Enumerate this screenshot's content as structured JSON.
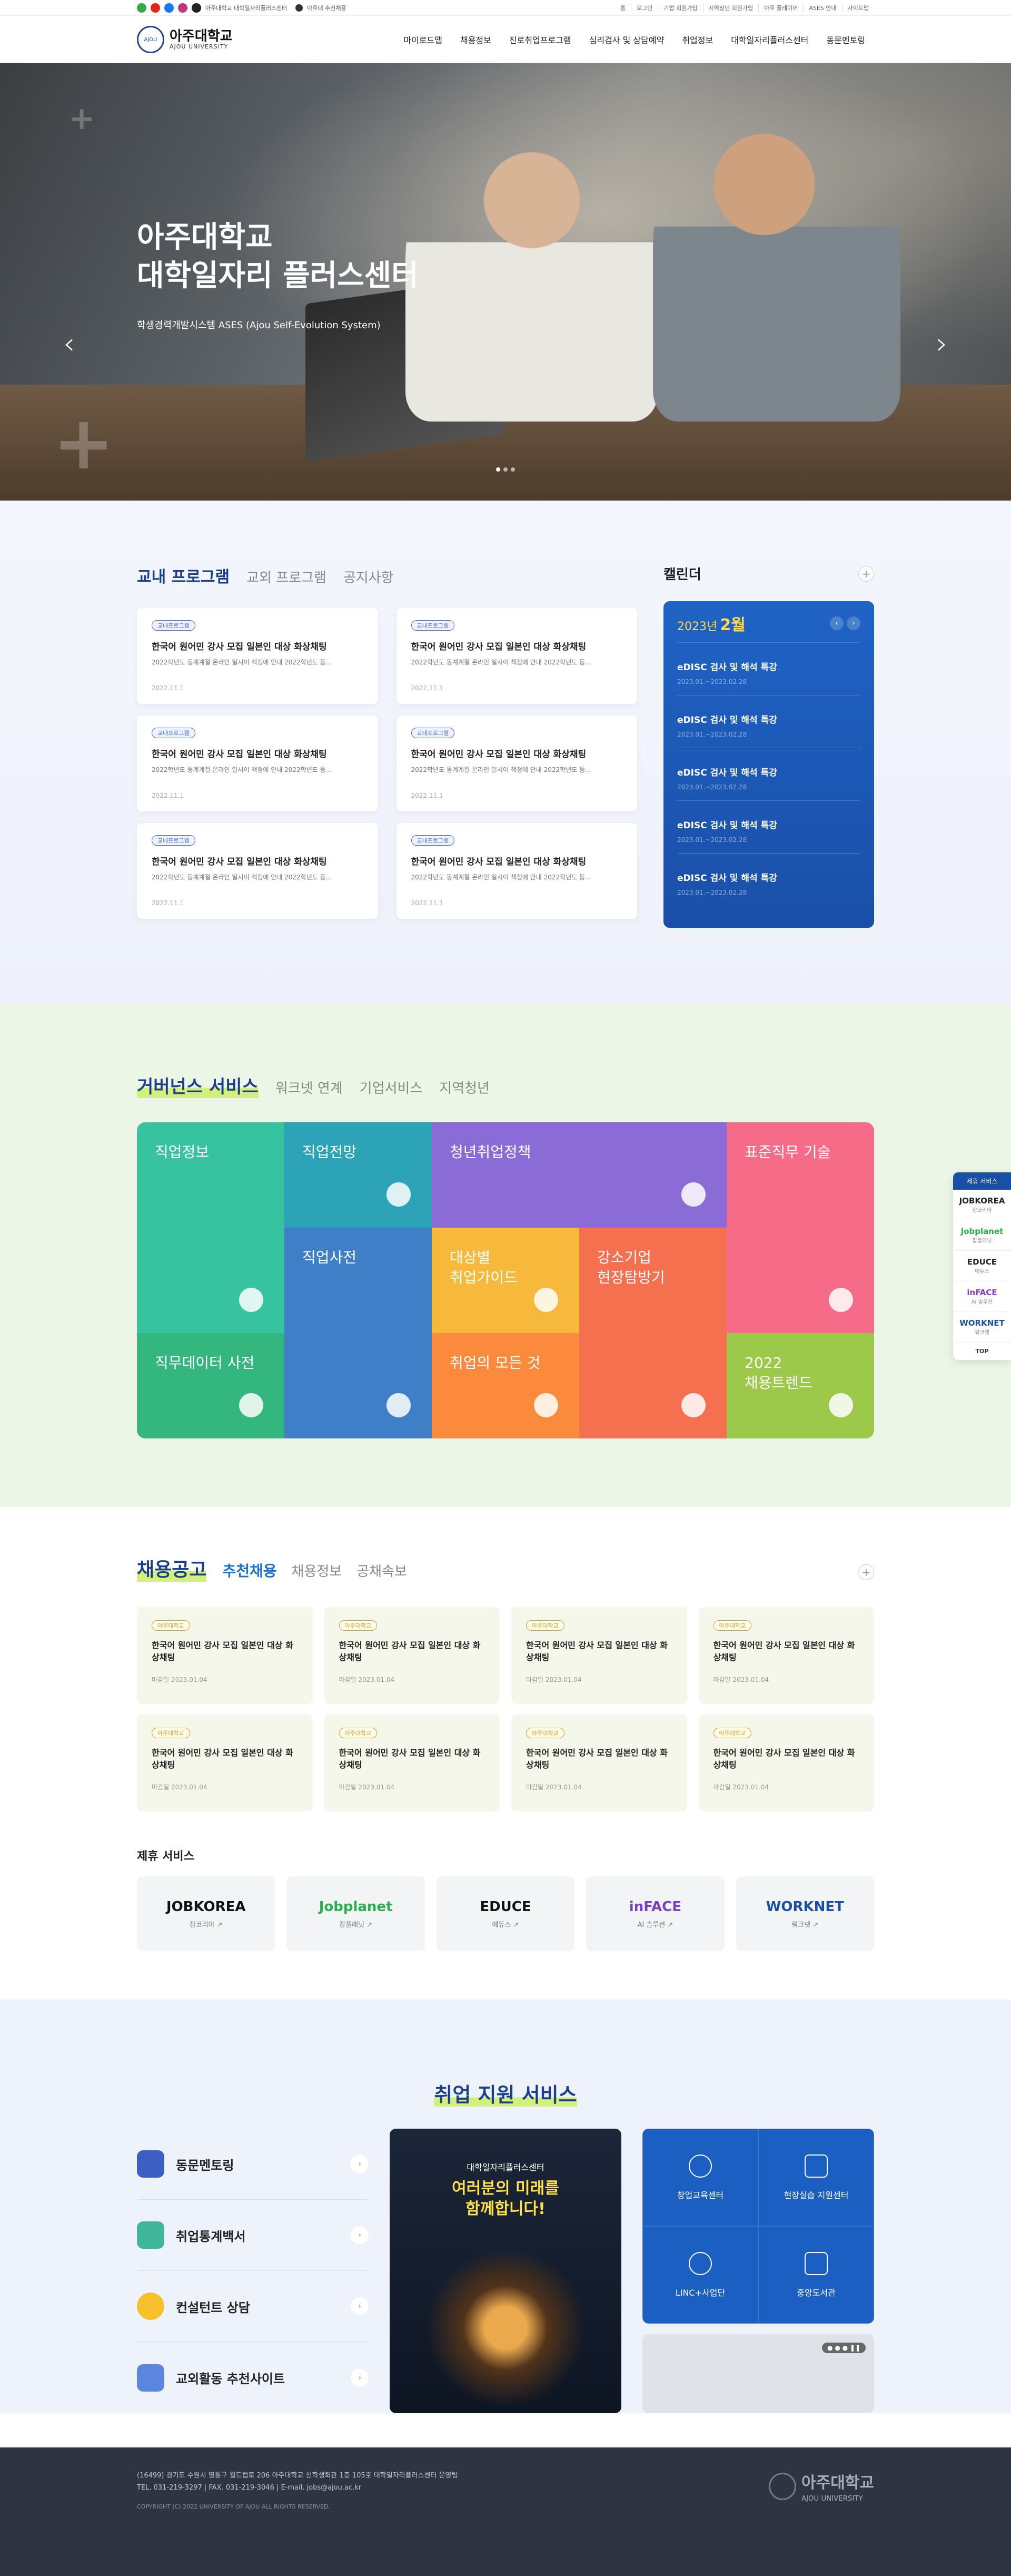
{
  "topbar": {
    "left_links": [
      "아주대학교 대학일자리플러스센터",
      "아주대 추천채용"
    ],
    "right_links": [
      "홈",
      "로그인",
      "기업 회원가입",
      "지역청년 회원가입",
      "아주 플레이어",
      "ASES 안내",
      "사이트맵"
    ]
  },
  "header": {
    "logo_name": "아주대학교",
    "logo_sub": "AJOU UNIVERSITY",
    "nav": [
      "마이로드맵",
      "채용정보",
      "진로취업프로그램",
      "심리검사 및 상담예약",
      "취업정보",
      "대학일자리플러스센터",
      "동문멘토링"
    ]
  },
  "hero": {
    "line1": "아주대학교",
    "line2": "대학일자리 플러스센터",
    "sub": "학생경력개발시스템 ASES (Ajou Self-Evolution System)",
    "prev": "‹",
    "next": "›"
  },
  "program": {
    "tabs": [
      "교내 프로그램",
      "교외 프로그램",
      "공지사항"
    ],
    "cards": [
      {
        "badge": "교내프로그램",
        "title": "한국어 원어민 강사 모집 일본인 대상 화상채팅",
        "desc": "2022학년도 동계계절 온라인 일시이 책정에 안내 2022학년도 동...",
        "date": "2022.11.1"
      },
      {
        "badge": "교내프로그램",
        "title": "한국어 원어민 강사 모집 일본인 대상 화상채팅",
        "desc": "2022학년도 동계계절 온라인 일시이 책정에 안내 2022학년도 동...",
        "date": "2022.11.1"
      },
      {
        "badge": "교내프로그램",
        "title": "한국어 원어민 강사 모집 일본인 대상 화상채팅",
        "desc": "2022학년도 동계계절 온라인 일시이 책정에 안내 2022학년도 동...",
        "date": "2022.11.1"
      },
      {
        "badge": "교내프로그램",
        "title": "한국어 원어민 강사 모집 일본인 대상 화상채팅",
        "desc": "2022학년도 동계계절 온라인 일시이 책정에 안내 2022학년도 동...",
        "date": "2022.11.1"
      },
      {
        "badge": "교내프로그램",
        "title": "한국어 원어민 강사 모집 일본인 대상 화상채팅",
        "desc": "2022학년도 동계계절 온라인 일시이 책정에 안내 2022학년도 동...",
        "date": "2022.11.1"
      },
      {
        "badge": "교내프로그램",
        "title": "한국어 원어민 강사 모집 일본인 대상 화상채팅",
        "desc": "2022학년도 동계계절 온라인 일시이 책정에 안내 2022학년도 동...",
        "date": "2022.11.1"
      }
    ]
  },
  "calendar": {
    "title": "캘린더",
    "year": "2023년",
    "month": "2월",
    "events": [
      {
        "title": "eDISC 검사 및 해석 특강",
        "date": "2023.01.~2023.02.28"
      },
      {
        "title": "eDISC 검사 및 해석 특강",
        "date": "2023.01.~2023.02.28"
      },
      {
        "title": "eDISC 검사 및 해석 특강",
        "date": "2023.01.~2023.02.28"
      },
      {
        "title": "eDISC 검사 및 해석 특강",
        "date": "2023.01.~2023.02.28"
      },
      {
        "title": "eDISC 검사 및 해석 특강",
        "date": "2023.01.~2023.02.28"
      }
    ]
  },
  "governance": {
    "tabs": [
      "거버넌스 서비스",
      "워크넷 연계",
      "기업서비스",
      "지역청년"
    ],
    "tiles": [
      "직업정보",
      "직업전망",
      "청년취업정책",
      "표준직무 기술",
      "직업사전",
      "대상별\n취업가이드",
      "강소기업\n현장탐방기",
      "직무데이터 사전",
      "취업의 모든 것",
      "2022\n채용트렌드"
    ]
  },
  "quick": {
    "title": "제휴 서비스",
    "items": [
      [
        "JOBKOREA",
        "잡코리아"
      ],
      [
        "Jobplanet",
        "잡플래닛"
      ],
      [
        "EDUCE",
        "에듀스"
      ],
      [
        "inFACE",
        "AI 솔루션"
      ],
      [
        "WORKNET",
        "워크넷"
      ]
    ],
    "top": "TOP"
  },
  "recruit": {
    "title": "채용공고",
    "tabs": [
      "추천채용",
      "채용정보",
      "공채속보"
    ],
    "jobs": [
      {
        "badge": "아주대학교",
        "title": "한국어 원어민 강사 모집 일본인 대상 화상채팅",
        "date": "마감일 2023.01.04"
      },
      {
        "badge": "아주대학교",
        "title": "한국어 원어민 강사 모집 일본인 대상 화상채팅",
        "date": "마감일 2023.01.04"
      },
      {
        "badge": "아주대학교",
        "title": "한국어 원어민 강사 모집 일본인 대상 화상채팅",
        "date": "마감일 2023.01.04"
      },
      {
        "badge": "아주대학교",
        "title": "한국어 원어민 강사 모집 일본인 대상 화상채팅",
        "date": "마감일 2023.01.04"
      },
      {
        "badge": "아주대학교",
        "title": "한국어 원어민 강사 모집 일본인 대상 화상채팅",
        "date": "마감일 2023.01.04"
      },
      {
        "badge": "아주대학교",
        "title": "한국어 원어민 강사 모집 일본인 대상 화상채팅",
        "date": "마감일 2023.01.04"
      },
      {
        "badge": "아주대학교",
        "title": "한국어 원어민 강사 모집 일본인 대상 화상채팅",
        "date": "마감일 2023.01.04"
      },
      {
        "badge": "아주대학교",
        "title": "한국어 원어민 강사 모집 일본인 대상 화상채팅",
        "date": "마감일 2023.01.04"
      }
    ]
  },
  "partners": {
    "title": "제휴 서비스",
    "items": [
      {
        "logo": "JOBKOREA",
        "name": "잡코리아 ↗",
        "color": "#111111"
      },
      {
        "logo": "Jobplanet",
        "name": "잡플래닛 ↗",
        "color": "#29b04a"
      },
      {
        "logo": "EDUCE",
        "name": "에듀스 ↗",
        "color": "#111111"
      },
      {
        "logo": "inFACE",
        "name": "AI 솔루션 ↗",
        "color": "#7a3fc4"
      },
      {
        "logo": "WORKNET",
        "name": "워크넷 ↗",
        "color": "#1a4fa8"
      }
    ]
  },
  "support": {
    "title": "취업 지원 서비스",
    "list": [
      "동문멘토링",
      "취업통계백서",
      "컨설턴트 상담",
      "교외활동 추천사이트"
    ],
    "poster_top": "대학일자리플러스센터",
    "poster_main": "여러분의 미래를\n함께합니다!",
    "grid": [
      "창업교육센터",
      "현장실습 지원센터",
      "LINC+사업단",
      "중앙도서관"
    ],
    "banner_ctl": "● ● ● ❚❚"
  },
  "footer": {
    "address": "(16499) 경기도 수원시 영통구 월드컵로 206 아주대학교 신학생회관 1층 105호 대학일자리플러스센터 운영팀",
    "contact": "TEL. 031-219-3297   |   FAX. 031-219-3046   |   E-mail. jobs@ajou.ac.kr",
    "copyright": "COPYRIGHT (C) 2022 UNIVERSITY OF AJOU ALL RIGHTS RESERVED.",
    "logo_name": "아주대학교",
    "logo_sub": "AJOU UNIVERSITY"
  }
}
